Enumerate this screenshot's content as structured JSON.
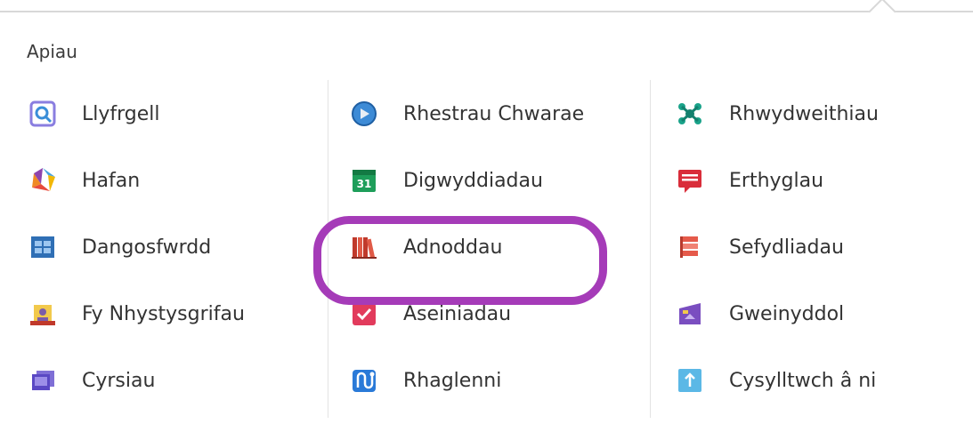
{
  "section": {
    "title": "Apiau"
  },
  "colors": {
    "highlight": "#a53bb8",
    "divider": "#e3e3e3"
  },
  "apps": {
    "col1": [
      {
        "label": "Llyfrgell",
        "icon": "library-search-icon"
      },
      {
        "label": "Hafan",
        "icon": "home-logo-icon"
      },
      {
        "label": "Dangosfwrdd",
        "icon": "dashboard-icon"
      },
      {
        "label": "Fy Nhystysgrifau",
        "icon": "certificate-icon"
      },
      {
        "label": "Cyrsiau",
        "icon": "courses-icon"
      }
    ],
    "col2": [
      {
        "label": "Rhestrau Chwarae",
        "icon": "playlist-icon"
      },
      {
        "label": "Digwyddiadau",
        "icon": "calendar-icon",
        "badge": "31"
      },
      {
        "label": "Adnoddau",
        "icon": "resources-books-icon",
        "selected": true
      },
      {
        "label": "Aseiniadau",
        "icon": "assignment-check-icon"
      },
      {
        "label": "Rhaglenni",
        "icon": "programs-icon"
      }
    ],
    "col3": [
      {
        "label": "Rhwydweithiau",
        "icon": "network-icon"
      },
      {
        "label": "Erthyglau",
        "icon": "article-icon"
      },
      {
        "label": "Sefydliadau",
        "icon": "organizations-icon"
      },
      {
        "label": "Gweinyddol",
        "icon": "admin-icon"
      },
      {
        "label": "Cysylltwch â ni",
        "icon": "contact-upload-icon"
      }
    ]
  }
}
